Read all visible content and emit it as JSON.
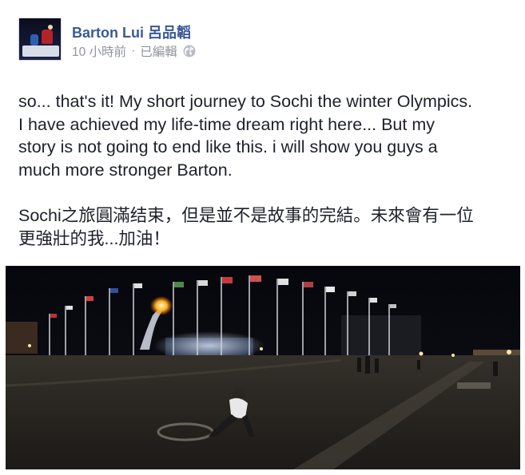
{
  "post": {
    "author": "Barton Lui 呂品韜",
    "time": "10 小時前",
    "separator": " · ",
    "edited": "已編輯",
    "audience_icon": "globe-icon",
    "text": {
      "en_1": "so... that's it! My short journey to Sochi the winter Olympics.",
      "en_2": "I have achieved my life-time dream right here... But my",
      "en_3": "story is not going to end like this. i will show you guys a",
      "en_4": "much more stronger Barton.",
      "zh_1": "Sochi之旅圓滿结束，但是並不是故事的完結。未來會有一位",
      "zh_2": "更強壯的我...加油！"
    }
  },
  "colors": {
    "author_link": "#3b5998",
    "meta_gray": "#90949c",
    "body_text": "#1d2129"
  }
}
